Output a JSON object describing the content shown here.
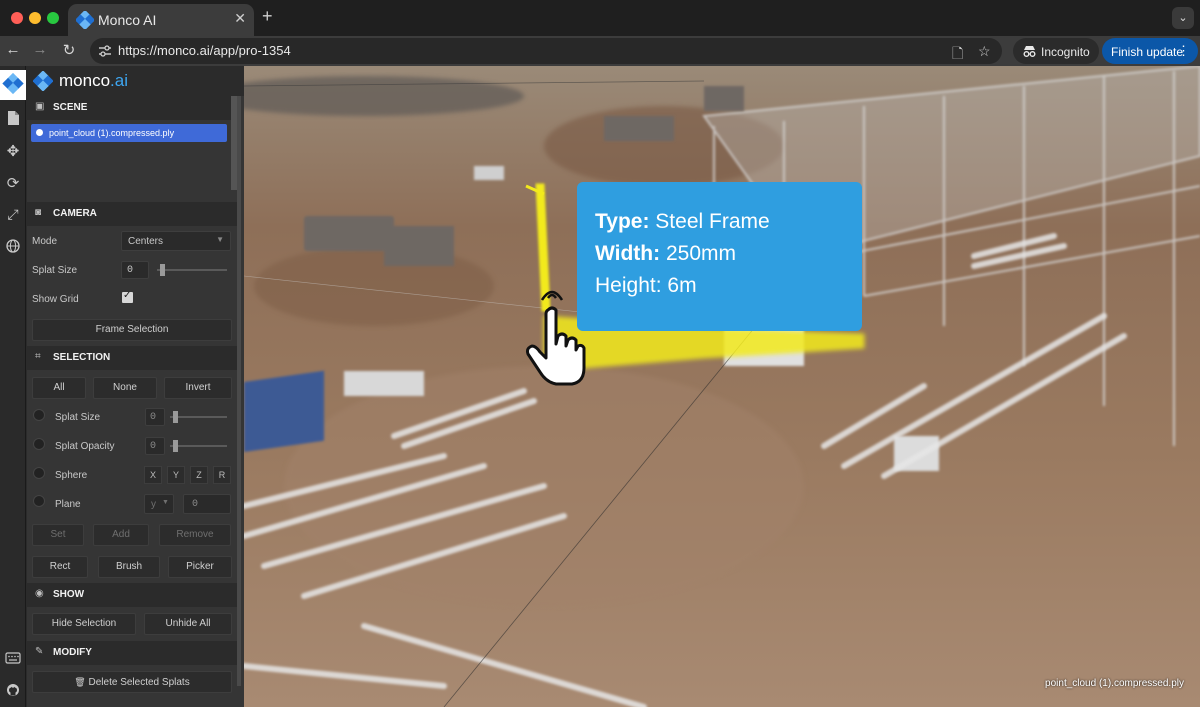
{
  "browser": {
    "tab_title": "Monco AI",
    "url": "https://monco.ai/app/pro-1354",
    "incognito_label": "Incognito",
    "finish_update_label": "Finish update",
    "colors": {
      "tabstrip": "#1f1f1f",
      "toolbar": "#3c3c3c",
      "accent": "#0b57a8"
    }
  },
  "app": {
    "brand": {
      "name": "monco",
      "dot": ".",
      "suffix": "ai"
    },
    "rail_icons": [
      "monco-logo-icon",
      "file-icon",
      "move-icon",
      "rotate-icon",
      "scale-icon",
      "globe-icon",
      "keyboard-icon",
      "github-icon"
    ],
    "scene": {
      "title": "SCENE",
      "items": [
        "point_cloud (1).compressed.ply"
      ]
    },
    "camera": {
      "title": "CAMERA",
      "mode_label": "Mode",
      "mode_value": "Centers",
      "splat_size_label": "Splat Size",
      "splat_size_value": "0",
      "show_grid_label": "Show Grid",
      "show_grid_checked": true,
      "frame_selection_label": "Frame Selection"
    },
    "selection": {
      "title": "SELECTION",
      "all": "All",
      "none": "None",
      "invert": "Invert",
      "splat_size_label": "Splat Size",
      "splat_size_value": "0",
      "splat_opacity_label": "Splat Opacity",
      "splat_opacity_value": "0",
      "sphere_label": "Sphere",
      "sphere_axes": [
        "X",
        "Y",
        "Z",
        "R"
      ],
      "plane_label": "Plane",
      "plane_axis": "y",
      "plane_value": "0",
      "set": "Set",
      "add": "Add",
      "remove": "Remove",
      "rect": "Rect",
      "brush": "Brush",
      "picker": "Picker"
    },
    "show": {
      "title": "SHOW",
      "hide_selection": "Hide Selection",
      "unhide_all": "Unhide All"
    },
    "modify": {
      "title": "MODIFY",
      "delete_selected": "Delete Selected Splats"
    }
  },
  "viewport": {
    "tooltip": {
      "type_label": "Type:",
      "type_value": "Steel Frame",
      "width_label": "Width:",
      "width_value": "250mm",
      "height_label": "Height:",
      "height_value": "6m",
      "color": "#2f9ee0"
    },
    "highlight_color": "#f2ea1c",
    "caption": "point_cloud (1).compressed.ply"
  }
}
